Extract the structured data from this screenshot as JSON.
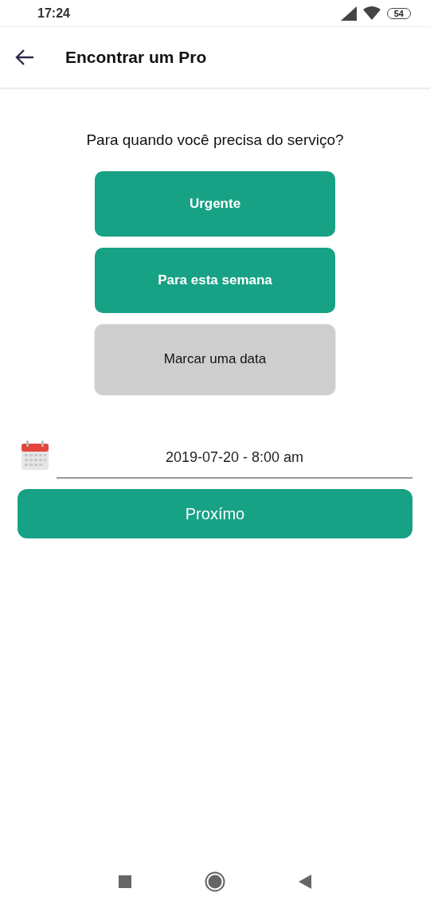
{
  "status_bar": {
    "time": "17:24",
    "battery": "54"
  },
  "app_bar": {
    "title": "Encontrar um Pro"
  },
  "question": "Para quando você precisa do serviço?",
  "options": [
    {
      "label": "Urgente",
      "selected": false
    },
    {
      "label": "Para esta semana",
      "selected": false
    },
    {
      "label": "Marcar uma data",
      "selected": true
    }
  ],
  "date_field": {
    "value": "2019-07-20 - 8:00 am"
  },
  "next_button": "Proxímo"
}
